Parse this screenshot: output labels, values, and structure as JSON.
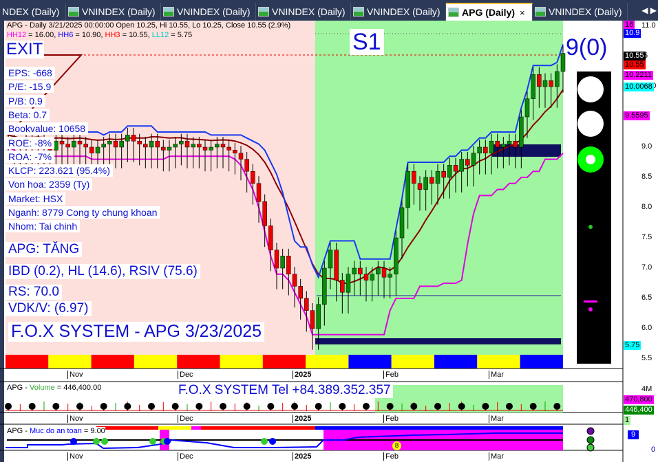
{
  "tabs": [
    {
      "label": "NDEX (Daily)",
      "active": false
    },
    {
      "label": "VNINDEX (Daily)",
      "active": false
    },
    {
      "label": "VNINDEX (Daily)",
      "active": false
    },
    {
      "label": "VNINDEX (Daily)",
      "active": false
    },
    {
      "label": "VNINDEX (Daily)",
      "active": false
    },
    {
      "label": "APG (Daily)",
      "active": true
    },
    {
      "label": "VNINDEX (Daily)",
      "active": false
    }
  ],
  "tab_close": "×",
  "tab_nav": "◀ ▶",
  "header": {
    "line1": "APG - Daily 3/21/2025 00:00:00 Open 10.25, Hi 10.55, Lo 10.25, Close 10.55 (2.9%)",
    "hh12": "HH12",
    "hh12_val": " = 16.00, ",
    "hh6": "HH6",
    "hh6_val": " = 10.90, ",
    "hh3": "HH3",
    "hh3_val": " = 10.55, ",
    "ll12": "LL12",
    "ll12_val": " = 5.75"
  },
  "signal": {
    "exit": "EXIT",
    "s1": "S1",
    "count": "9(0)"
  },
  "fundamentals": [
    "EPS: -668",
    "P/E: -15.9",
    "P/B: 0.9",
    "Beta: 0.7",
    "Bookvalue: 10658",
    "ROE: -8%",
    "ROA: -7%",
    "KLCP: 223.621 (95.4%)",
    "Von hoa: 2359 (Ty)",
    "Market: HSX",
    "Nganh: 8779 Cong ty chung khoan",
    "Nhom: Tai chinh"
  ],
  "summary": {
    "trend": "APG: TĂNG",
    "ibd": "IBD (0.2), HL (14.6), RSIV (75.6)",
    "rs": "RS: 70.0",
    "vdk": "VDK/V:  (6.97)",
    "system": "F.O.X SYSTEM - APG 3/23/2025"
  },
  "price_axis": {
    "ticks": [
      "11.0",
      ".5",
      "10.0",
      ".5",
      "9.0",
      "8.5",
      "8.0",
      "7.5",
      "7.0",
      "6.5",
      "6.0",
      "5.5"
    ],
    "tags": [
      {
        "text": "16",
        "bg": "#ff00ff",
        "fg": "#000"
      },
      {
        "text": "10.9",
        "bg": "#0000ff",
        "fg": "#fff"
      },
      {
        "text": "10.55",
        "bg": "#000",
        "fg": "#fff"
      },
      {
        "text": "10.55",
        "bg": "#ff0000",
        "fg": "#000"
      },
      {
        "text": "10.2211",
        "bg": "#ff00ff",
        "fg": "#000"
      },
      {
        "text": "10.0068",
        "bg": "#00ffff",
        "fg": "#000"
      },
      {
        "text": "9.5595",
        "bg": "#ff00ff",
        "fg": "#000"
      },
      {
        "text": "5.75",
        "bg": "#00ffff",
        "fg": "#000"
      }
    ]
  },
  "date_axis": [
    "Nov",
    "Dec",
    "2025",
    "Feb",
    "Mar"
  ],
  "volume": {
    "title_prefix": "APG - ",
    "title_name": "Volume",
    "title_value": " = 446,400.00",
    "banner": "F.O.X SYSTEM Tel +84.389.352.357",
    "axis_top": "4M",
    "tag1": "470,800",
    "tag2": "446,400",
    "tag3": "1"
  },
  "safety": {
    "title_prefix": "APG - ",
    "title_name": "Muc do an toan",
    "title_value": " = 9.00",
    "tag": "9",
    "axis_zero": "0",
    "marker": "8"
  },
  "chart_data": {
    "type": "candlestick",
    "symbol": "APG",
    "ylim": [
      5.5,
      11.0
    ],
    "closes": [
      9.1,
      9.05,
      9.0,
      9.1,
      9.05,
      9.1,
      9.0,
      8.95,
      9.1,
      9.05,
      9.0,
      9.1,
      9.05,
      9.0,
      8.9,
      9.0,
      9.05,
      9.1,
      9.0,
      9.1,
      9.2,
      9.1,
      9.05,
      9.0,
      9.1,
      9.0,
      8.95,
      9.0,
      9.05,
      9.1,
      9.0,
      9.05,
      9.0,
      8.95,
      9.0,
      9.05,
      9.0,
      8.95,
      8.9,
      8.8,
      8.6,
      8.4,
      8.1,
      7.7,
      7.3,
      7.0,
      7.2,
      6.9,
      6.7,
      6.5,
      6.3,
      6.0,
      6.4,
      7.0,
      7.3,
      6.8,
      6.6,
      6.9,
      7.0,
      6.9,
      6.8,
      6.9,
      7.0,
      6.85,
      6.9,
      7.5,
      8.0,
      8.6,
      8.4,
      8.3,
      8.5,
      8.4,
      8.6,
      8.5,
      8.7,
      8.6,
      8.8,
      8.7,
      8.9,
      9.0,
      8.9,
      9.1,
      9.0,
      9.05,
      9.1,
      9.0,
      9.5,
      9.8,
      10.2,
      10.0,
      10.1,
      10.0,
      10.25,
      10.55
    ]
  }
}
